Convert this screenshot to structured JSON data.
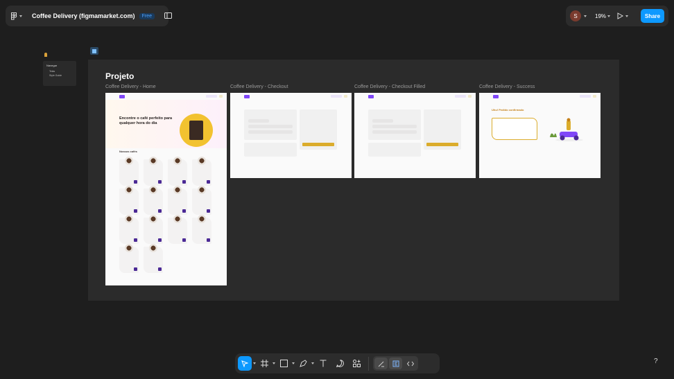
{
  "header": {
    "file_title": "Coffee Delivery (figmamarket.com)",
    "plan_badge": "Free",
    "avatar_initial": "S",
    "zoom_level": "19%",
    "share_label": "Share"
  },
  "canvas": {
    "section_title": "Projeto",
    "mini_nav": {
      "title": "Navegar",
      "items": [
        "Telas",
        "Style Guide"
      ]
    },
    "frames": [
      {
        "label": "Coffee Delivery - Home"
      },
      {
        "label": "Coffee Delivery - Checkout"
      },
      {
        "label": "Coffee Delivery - Checkout Filled"
      },
      {
        "label": "Coffee Delivery - Success"
      }
    ],
    "home": {
      "hero_text": "Encontre o café perfeito para qualquer hora do dia",
      "list_heading": "Nossos cafés"
    },
    "success": {
      "title": "Uhu! Pedido confirmado"
    }
  },
  "toolbar": {
    "tools": [
      "move-tool",
      "frame-tool",
      "shape-tool",
      "pen-tool",
      "text-tool",
      "comment-tool",
      "actions-tool"
    ],
    "modes": [
      "draw-mode",
      "design-mode",
      "dev-mode"
    ]
  },
  "help_label": "?",
  "colors": {
    "canvas_bg": "#1e1e1e",
    "panel_bg": "#2c2c2c",
    "accent": "#0d99ff",
    "coffee_yellow": "#dbac2c",
    "coffee_purple": "#8047f8"
  }
}
